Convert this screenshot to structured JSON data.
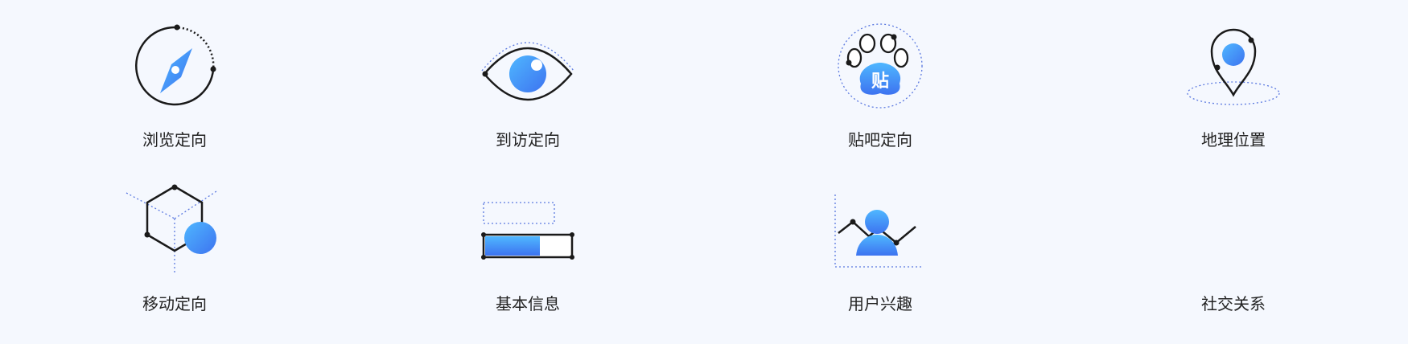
{
  "colors": {
    "gradient_start": "#4fb7ff",
    "gradient_end": "#3d73f0",
    "stroke": "#1a1a1a",
    "dotted": "#5b79e0",
    "background": "#f5f8fe"
  },
  "features": [
    {
      "label": "浏览定向",
      "icon": "compass-icon"
    },
    {
      "label": "到访定向",
      "icon": "eye-icon"
    },
    {
      "label": "贴吧定向",
      "icon": "paw-icon",
      "icon_text": "贴"
    },
    {
      "label": "地理位置",
      "icon": "location-pin-icon"
    },
    {
      "label": "移动定向",
      "icon": "hexagon-device-icon"
    },
    {
      "label": "基本信息",
      "icon": "info-bar-icon"
    },
    {
      "label": "用户兴趣",
      "icon": "user-interest-chart-icon"
    },
    {
      "label": "社交关系",
      "icon": "social-icon"
    }
  ]
}
